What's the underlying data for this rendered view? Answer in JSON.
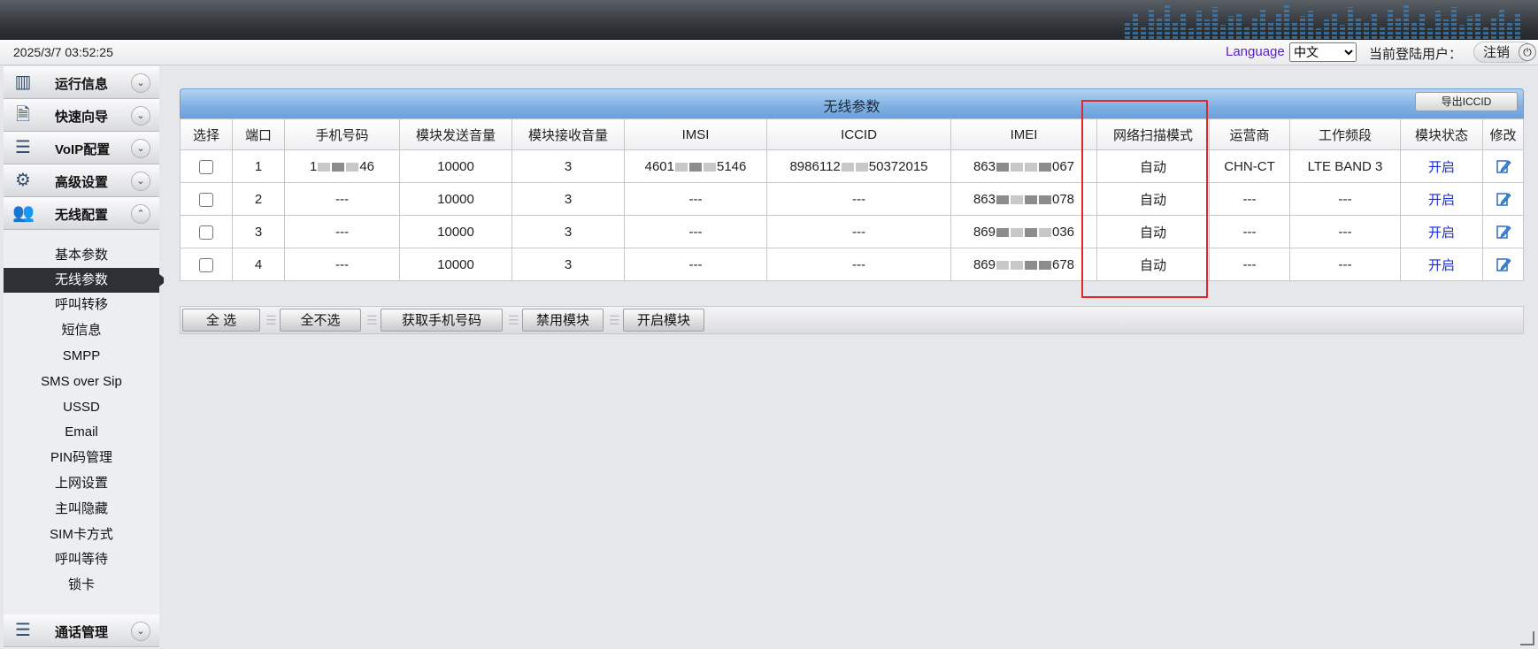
{
  "status_bar": {
    "datetime": "2025/3/7 03:52:25",
    "language_label": "Language",
    "language_value": "中文",
    "current_user_label": "当前登陆用户：",
    "logout_label": "注销"
  },
  "sidebar": {
    "menus": [
      {
        "label": "运行信息",
        "icon": "bars-icon"
      },
      {
        "label": "快速向导",
        "icon": "document-icon"
      },
      {
        "label": "VoIP配置",
        "icon": "sliders-icon"
      },
      {
        "label": "高级设置",
        "icon": "gear-icon"
      },
      {
        "label": "无线配置",
        "icon": "users-icon"
      }
    ],
    "sub_items": [
      "基本参数",
      "无线参数",
      "呼叫转移",
      "短信息",
      "SMPP",
      "SMS over Sip",
      "USSD",
      "Email",
      "PIN码管理",
      "上网设置",
      "主叫隐藏",
      "SIM卡方式",
      "呼叫等待",
      "锁卡"
    ],
    "active_sub": "无线参数",
    "bottom_menu": {
      "label": "通话管理",
      "icon": "sliders-icon"
    }
  },
  "panel": {
    "title": "无线参数",
    "export_button": "导出ICCID",
    "columns": [
      "选择",
      "端口",
      "手机号码",
      "模块发送音量",
      "模块接收音量",
      "IMSI",
      "ICCID",
      "IMEI",
      "网络扫描模式",
      "运营商",
      "工作频段",
      "模块状态",
      "修改"
    ],
    "rows": [
      {
        "port": "1",
        "phone_a": "1",
        "phone_b": "46",
        "tx": "10000",
        "rx": "3",
        "imsi_a": "4601",
        "imsi_b": "5146",
        "iccid_a": "8986112",
        "iccid_b": "50372015",
        "imei_a": "863",
        "imei_b": "067",
        "scan": "自动",
        "carrier": "CHN-CT",
        "band": "LTE BAND 3",
        "state": "开启"
      },
      {
        "port": "2",
        "phone": "---",
        "tx": "10000",
        "rx": "3",
        "imsi": "---",
        "iccid": "---",
        "imei_a": "863",
        "imei_b": "078",
        "scan": "自动",
        "carrier": "---",
        "band": "---",
        "state": "开启"
      },
      {
        "port": "3",
        "phone": "---",
        "tx": "10000",
        "rx": "3",
        "imsi": "---",
        "iccid": "---",
        "imei_a": "869",
        "imei_b": "036",
        "scan": "自动",
        "carrier": "---",
        "band": "---",
        "state": "开启"
      },
      {
        "port": "4",
        "phone": "---",
        "tx": "10000",
        "rx": "3",
        "imsi": "---",
        "iccid": "---",
        "imei_a": "869",
        "imei_b": "678",
        "scan": "自动",
        "carrier": "---",
        "band": "---",
        "state": "开启"
      }
    ]
  },
  "toolbar": {
    "select_all": "全  选",
    "select_none": "全不选",
    "get_phone": "获取手机号码",
    "disable_module": "禁用模块",
    "enable_module": "开启模块"
  }
}
